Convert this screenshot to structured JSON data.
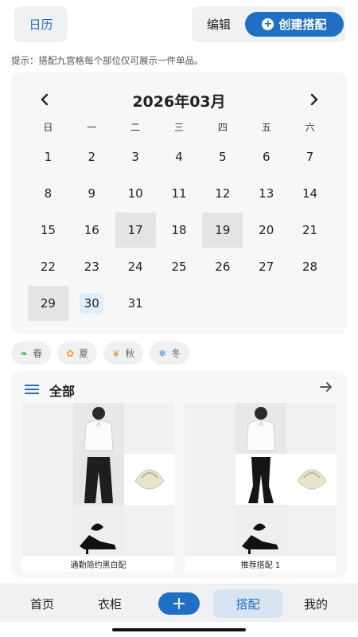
{
  "header": {
    "calendar_label": "日历",
    "edit_label": "编辑",
    "create_label": "创建搭配"
  },
  "tip": "提示：搭配九宫格每个部位仅可展示一件单品。",
  "calendar": {
    "title": "2026年03月",
    "weekdays": [
      "日",
      "一",
      "二",
      "三",
      "四",
      "五",
      "六"
    ],
    "days": [
      "1",
      "2",
      "3",
      "4",
      "5",
      "6",
      "7",
      "8",
      "9",
      "10",
      "11",
      "12",
      "13",
      "14",
      "15",
      "16",
      "17",
      "18",
      "19",
      "20",
      "21",
      "22",
      "23",
      "24",
      "25",
      "26",
      "27",
      "28",
      "29",
      "30",
      "31"
    ],
    "marked_days": [
      "17",
      "19",
      "29"
    ],
    "today": "30"
  },
  "seasons": [
    {
      "label": "春",
      "icon": "leaf-icon",
      "color": "#4caf50"
    },
    {
      "label": "夏",
      "icon": "sun-icon",
      "color": "#e8a33d"
    },
    {
      "label": "秋",
      "icon": "autumn-leaf-icon",
      "color": "#d9a441"
    },
    {
      "label": "冬",
      "icon": "snowflake-icon",
      "color": "#3d8fd8"
    }
  ],
  "outfits": {
    "title": "全部",
    "items": [
      {
        "name": "通勤简约黑白配"
      },
      {
        "name": "推荐搭配 1"
      }
    ]
  },
  "nav": {
    "home": "首页",
    "closet": "衣柜",
    "add": "+",
    "outfit": "搭配",
    "me": "我的"
  },
  "colors": {
    "accent": "#1f6fc5",
    "panel_bg": "#f7f7f8",
    "marked_day": "#e4e4e6",
    "today_bg": "#dfeefc"
  }
}
